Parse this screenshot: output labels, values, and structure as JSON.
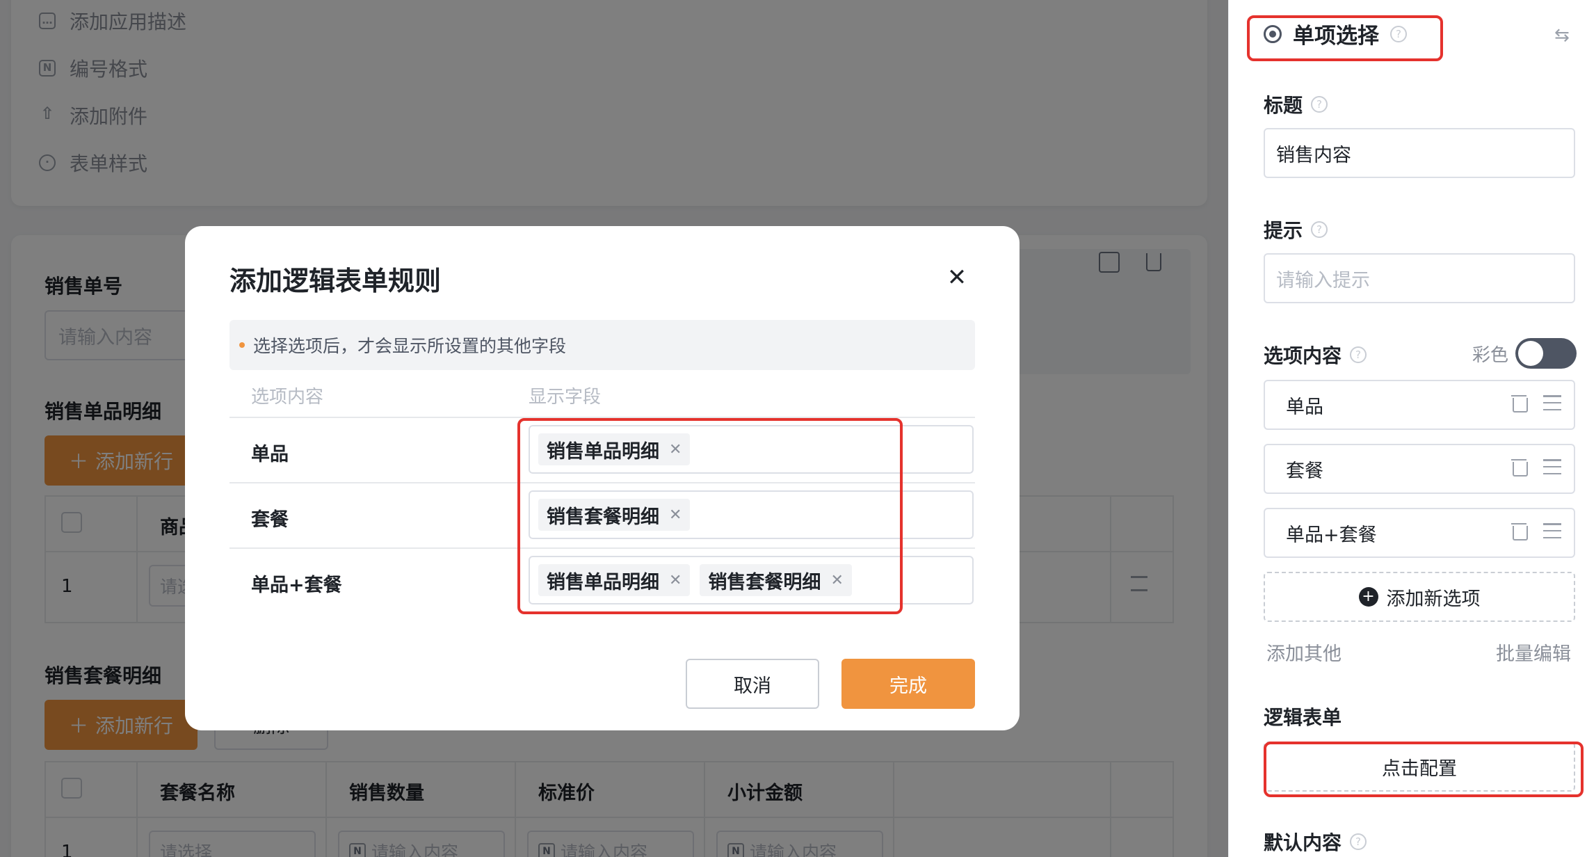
{
  "left_menu": [
    {
      "icon": "comment-icon",
      "label": "添加应用描述"
    },
    {
      "icon": "number-icon",
      "label": "编号格式"
    },
    {
      "icon": "upload-icon",
      "label": "添加附件"
    },
    {
      "icon": "palette-icon",
      "label": "表单样式"
    }
  ],
  "form": {
    "sales_no_label": "销售单号",
    "sales_no_placeholder": "请输入内容",
    "single_detail_label": "销售单品明细",
    "add_row": "添加新行",
    "single_table_first_col": "商品",
    "row_index": "1",
    "single_row_placeholder": "请选",
    "package_detail_label": "销售套餐明细",
    "package_extra_button": "删除",
    "package_headers": [
      "套餐名称",
      "销售数量",
      "标准价",
      "小计金额"
    ],
    "package_row_select_placeholder": "请选择",
    "package_row_input_placeholder": "请输入内容"
  },
  "dialog": {
    "title": "添加逻辑表单规则",
    "tip": "选择选项后，才会显示所设置的其他字段",
    "col_option": "选项内容",
    "col_fields": "显示字段",
    "rules": [
      {
        "option": "单品",
        "fields": [
          "销售单品明细"
        ]
      },
      {
        "option": "套餐",
        "fields": [
          "销售套餐明细"
        ]
      },
      {
        "option": "单品+套餐",
        "fields": [
          "销售单品明细",
          "销售套餐明细"
        ]
      }
    ],
    "cancel": "取消",
    "done": "完成"
  },
  "panel": {
    "widget_title": "单项选择",
    "title_label": "标题",
    "title_value": "销售内容",
    "hint_label": "提示",
    "hint_placeholder": "请输入提示",
    "options_label": "选项内容",
    "color_label": "彩色",
    "color_enabled": false,
    "options": [
      "单品",
      "套餐",
      "单品+套餐"
    ],
    "add_option": "添加新选项",
    "add_other": "添加其他",
    "batch_edit": "批量编辑",
    "logic_label": "逻辑表单",
    "logic_button": "点击配置",
    "default_label": "默认内容"
  },
  "colors": {
    "accent": "#f0943f",
    "highlight_border": "#e5322d"
  }
}
